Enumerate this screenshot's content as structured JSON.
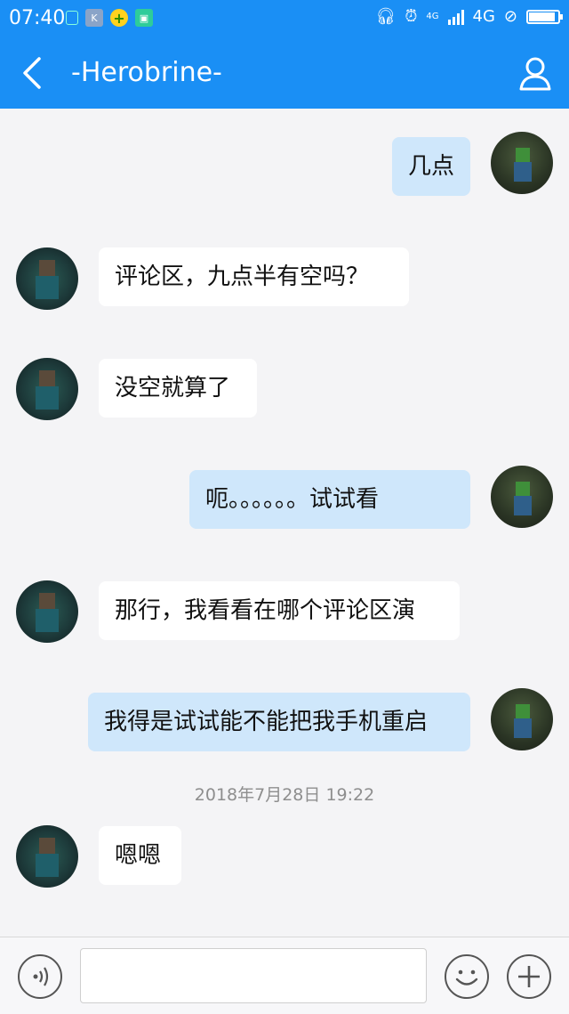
{
  "status_bar": {
    "time": "07:40",
    "network": "4G",
    "network_small": "4G"
  },
  "header": {
    "title": "-Herobrine-"
  },
  "messages": [
    {
      "side": "me",
      "text": "几点"
    },
    {
      "side": "them",
      "text": "评论区，九点半有空吗？"
    },
    {
      "side": "them",
      "text": "没空就算了"
    },
    {
      "side": "me",
      "text": "呃。。。。。。试试看"
    },
    {
      "side": "them",
      "text": "那行，我看看在哪个评论区演"
    },
    {
      "side": "me",
      "text": "我得是试试能不能把我手机重启"
    },
    {
      "side": "them",
      "text": "嗯嗯"
    }
  ],
  "timestamp": "2018年7月28日 19:22",
  "input": {
    "value": "",
    "placeholder": ""
  },
  "colors": {
    "accent": "#1a8ff5",
    "my_bubble": "#cfe7fb",
    "their_bubble": "#ffffff",
    "background": "#f4f4f6"
  }
}
